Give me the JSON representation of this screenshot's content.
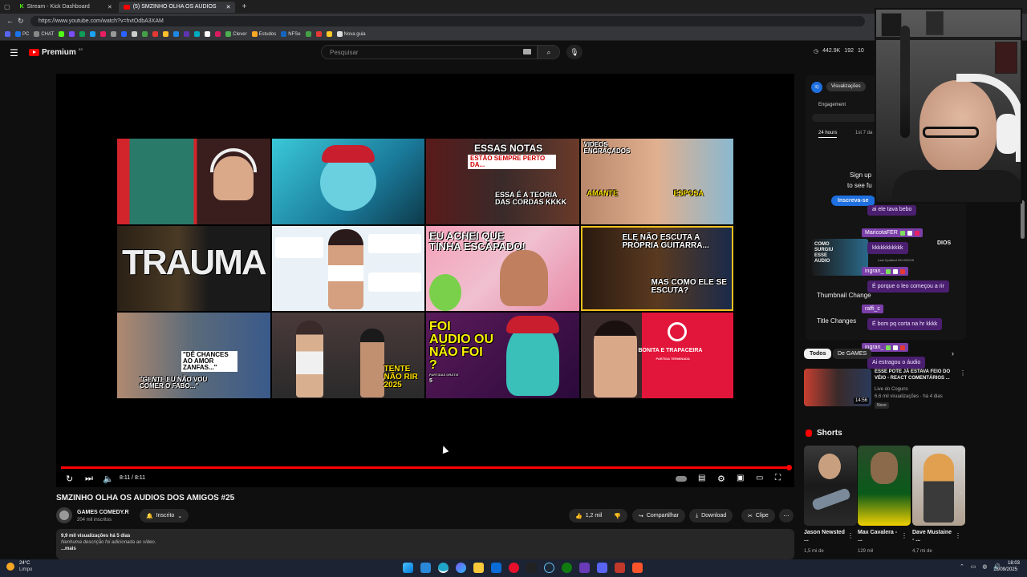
{
  "browser": {
    "tabs": [
      {
        "label": "Stream - Kick Dashboard",
        "active": false
      },
      {
        "label": "(5) SMZINHO OLHA OS AUDIOS",
        "active": true
      }
    ],
    "url": "https://www.youtube.com/watch?v=hvtOdbA3XAM",
    "bookmarks": [
      "PC",
      "CHAT",
      "Clever",
      "Estudos",
      "NFSe",
      "Nova guia"
    ]
  },
  "header": {
    "logo_text": "Premium",
    "logo_badge": "BR",
    "search_placeholder": "Pesquisar"
  },
  "thumbnails": {
    "t3_top": "ESSAS NOTAS",
    "t3_mid": "ESTÃO SEMPRE PERTO DA...",
    "t3_bot": "ESSA É A TEORIA DAS CORDAS KKKK",
    "t4_top": "VIDEOS ENGRAÇADOS",
    "t4_a": "AMANTE",
    "t4_b": "ESPOSA",
    "t5": "TRAUMA",
    "t7": "EU ACHEI QUE TINHA ESCAPADO!",
    "t8_top": "ELE NÃO ESCUTA A PRÓPRIA GUITARRA...",
    "t8_bot": "MAS COMO ELE SE ESCUTA?",
    "t9_a": "\"DÊ CHANCES AO AMOR ZANFAS...\"",
    "t9_b": "\"GENTE EU NÃO VOU COMER O FABO...\"",
    "t10": "TENTE NÃO RIR 2025",
    "t11": "FOI AUDIO OU NÃO FOI ?",
    "t11_sub": "PARTIDAS GRÁTIS",
    "t11_num": "5",
    "t12_a": "BONITA E TRAPACEIRA",
    "t12_b": "PARTIDA TERMINADA"
  },
  "player": {
    "time": "8:11 / 8:11",
    "progress": 1.0
  },
  "video": {
    "title": "SMZINHO OLHA OS AUDIOS DOS AMIGOS #25",
    "channel": "GAMES COMEDY.R",
    "subscribers": "204 mil inscritos",
    "subscribe_label": "Inscrito",
    "likes": "1,2 mil",
    "share": "Compartilhar",
    "download": "Download",
    "clip": "Clipe",
    "views_line": "9,9 mil visualizações  há 5 dias",
    "description": "Nenhuma descrição foi adicionada ao vídeo.",
    "more": "...mais"
  },
  "stats": {
    "viewers": "442.9K",
    "a": "192",
    "b": "10"
  },
  "analytics": {
    "tab": "Visualizações",
    "engagement": "Engagement",
    "period_a": "24 hours",
    "period_b": "1st 7 da",
    "signup_a": "Sign up",
    "signup_b": "to see fu",
    "signup_btn": "Inscreva-se",
    "thumb_text_a": "COMO SURGIU ESSE AUDIO",
    "last_updated": "Last Updated 09/13/2025",
    "audios": "DIOS",
    "thumbnail_changes": "Thumbnail Change",
    "title_changes": "Title Changes"
  },
  "chat": [
    {
      "user": "",
      "message": "ai ele tava bebo"
    },
    {
      "user": "MaricotaFER",
      "message": "kkkkkkkkkkk"
    },
    {
      "user": "ingran_",
      "message": "É porque o leo começou a rir"
    },
    {
      "user": "raffi_c",
      "message": "É bom pq corta na hr kkkk"
    },
    {
      "user": "ingran_",
      "message": "Ai estragou o áudio"
    }
  ],
  "filters": {
    "all": "Todos",
    "games": "De GAMES"
  },
  "recommended": {
    "title": "ESSE POTE JÁ ESTAVA FEIO DO VÉIO - REACT COMENTÁRIOS ...",
    "channel": "Live do Coguns",
    "meta": "6,6 mil visualizações · há 4 dias",
    "badge": "Novo",
    "duration": "14:56"
  },
  "shorts": {
    "header": "Shorts",
    "items": [
      {
        "title": "Jason Newsted ...",
        "views": "1,5 mi de"
      },
      {
        "title": "Max Cavalera - ...",
        "views": "129 mil"
      },
      {
        "title": "Dave Mustaine - ...",
        "views": "4,7 mi de"
      }
    ]
  },
  "taskbar": {
    "temp": "24°C",
    "weather": "Limpo",
    "time": "18:03",
    "date": "18/09/2025"
  }
}
